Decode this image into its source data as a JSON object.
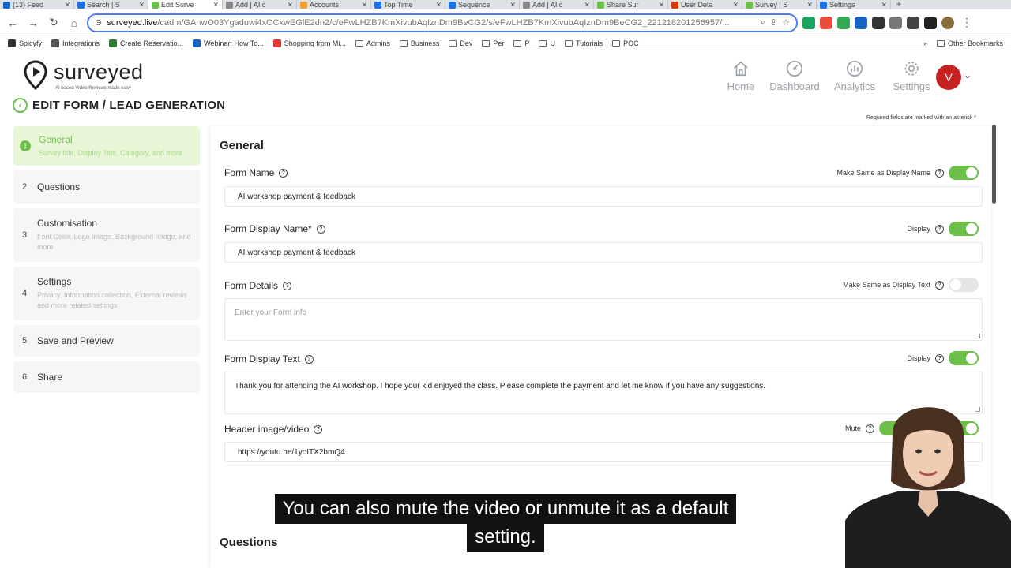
{
  "browser": {
    "tabs": [
      {
        "label": "(13) Feed",
        "color": "#0a66c2"
      },
      {
        "label": "Search | S",
        "color": "#1a73e8"
      },
      {
        "label": "Edit Surve",
        "color": "#6cc04a",
        "active": true
      },
      {
        "label": "Add | AI c",
        "color": "#888"
      },
      {
        "label": "Accounts",
        "color": "#f0a030"
      },
      {
        "label": "Top Time",
        "color": "#1a73e8"
      },
      {
        "label": "Sequence",
        "color": "#1a73e8"
      },
      {
        "label": "Add | AI c",
        "color": "#888"
      },
      {
        "label": "Share Sur",
        "color": "#6cc04a"
      },
      {
        "label": "User Deta",
        "color": "#d83b01"
      },
      {
        "label": "Survey | S",
        "color": "#6cc04a"
      },
      {
        "label": "Settings",
        "color": "#1a73e8"
      }
    ],
    "new_tab": "+",
    "url_host": "surveyed.live",
    "url_path": "/cadm/GAnwO03Ygaduwi4xOCxwEGlE2dn2/c/eFwLHZB7KmXivubAqIznDm9BeCG2/s/eFwLHZB7KmXivubAqIznDm9BeCG2_221218201256957/...",
    "bookmarks": [
      "Spicyfy",
      "Integrations",
      "Create Reservatio...",
      "Webinar: How To...",
      "Shopping from Mi...",
      "Admins",
      "Business",
      "Dev",
      "Per",
      "P",
      "U",
      "Tutorials",
      "POC"
    ],
    "other_bookmarks": "Other Bookmarks",
    "more_bookmarks": "»"
  },
  "app": {
    "logo_text": "surveyed",
    "logo_tagline": "AI based Video Reviews made easy",
    "nav": [
      {
        "label": "Home",
        "icon": "home-icon"
      },
      {
        "label": "Dashboard",
        "icon": "dashboard-icon"
      },
      {
        "label": "Analytics",
        "icon": "analytics-icon"
      },
      {
        "label": "Settings",
        "icon": "settings-icon"
      }
    ],
    "avatar_initial": "V",
    "page_title": "EDIT FORM / LEAD GENERATION",
    "required_note": "Required fields are marked with an asterisk *"
  },
  "steps": [
    {
      "num": "1",
      "title": "General",
      "desc": "Survey title, Display Title, Category, and more",
      "active": true
    },
    {
      "num": "2",
      "title": "Questions",
      "desc": ""
    },
    {
      "num": "3",
      "title": "Customisation",
      "desc": "Font Color, Logo Image, Background Image, and more"
    },
    {
      "num": "4",
      "title": "Settings",
      "desc": "Privacy, Information collection, External reviews and more related settings"
    },
    {
      "num": "5",
      "title": "Save and Preview",
      "desc": ""
    },
    {
      "num": "6",
      "title": "Share",
      "desc": ""
    }
  ],
  "form": {
    "section_title": "General",
    "form_name": {
      "label": "Form Name",
      "value": "AI workshop payment & feedback",
      "toggle_label": "Make Same as Display Name",
      "toggle_on": true
    },
    "display_name": {
      "label": "Form Display Name*",
      "value": "AI workshop payment & feedback",
      "toggle_label": "Display",
      "toggle_on": true
    },
    "details": {
      "label": "Form Details",
      "placeholder": "Enter your Form info",
      "toggle_label": "Make Same as Display Text",
      "toggle_on": false
    },
    "display_text": {
      "label": "Form Display Text",
      "value": "Thank you for attending the AI workshop. I hope your kid enjoyed the class. Please complete the payment and let me know if you have any suggestions.",
      "toggle_label": "Display",
      "toggle_on": true
    },
    "header_media": {
      "label": "Header image/video",
      "value": "https://youtu.be/1yoITX2bmQ4",
      "mute_label": "Mute",
      "mute_on": true,
      "autoplay_label": "A"
    },
    "next_section": "Questions"
  },
  "captions": {
    "line1": "You can also mute the video or unmute it as a default",
    "line2": "setting."
  }
}
